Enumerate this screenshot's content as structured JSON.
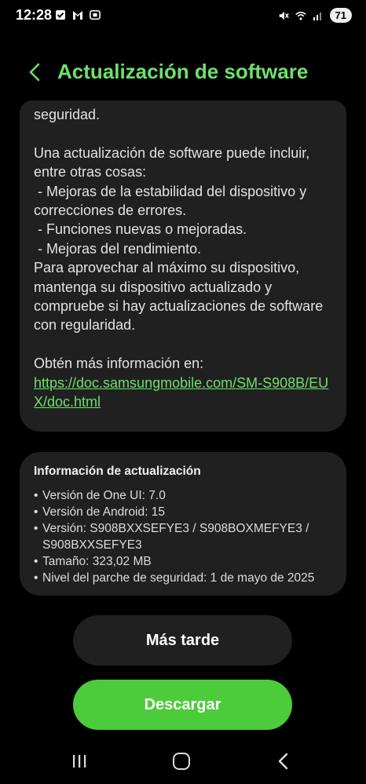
{
  "status_bar": {
    "time": "12:28",
    "left_icons": [
      "checkbox-icon",
      "gmail-icon",
      "screenshot-icon"
    ],
    "right_icons": [
      "mute-icon",
      "wifi-icon",
      "signal-icon"
    ],
    "battery": "71"
  },
  "header": {
    "title": "Actualización de software",
    "back_icon": "chevron-left-icon"
  },
  "description": {
    "line_security": "seguridad.",
    "intro": "Una actualización de software puede incluir, entre otras cosas:",
    "item1": " - Mejoras de la estabilidad del dispositivo y correcciones de errores.",
    "item2": " - Funciones nuevas o mejoradas.",
    "item3": " - Mejoras del rendimiento.",
    "advice": "Para aprovechar al máximo su dispositivo, mantenga su dispositivo actualizado y compruebe si hay actualizaciones de software con regularidad.",
    "more_info": "Obtén más información en:",
    "link": "https://doc.samsungmobile.com/SM-S908B/EUX/doc.html"
  },
  "update_info": {
    "title": "Información de actualización",
    "items": [
      "Versión de One UI: 7.0",
      "Versión de Android: 15",
      "Versión: S908BXXSEFYE3 / S908BOXMEFYE3 / S908BXXSEFYE3",
      "Tamaño: 323,02 MB",
      "Nivel del parche de seguridad: 1 de mayo de 2025"
    ]
  },
  "buttons": {
    "later": "Más tarde",
    "download": "Descargar"
  },
  "colors": {
    "accent": "#6ee06c",
    "download_button": "#4ccc3b",
    "card_bg": "#202020",
    "background": "#000000"
  },
  "nav_bar": {
    "icons": [
      "recent-apps-icon",
      "home-icon",
      "back-icon"
    ]
  }
}
